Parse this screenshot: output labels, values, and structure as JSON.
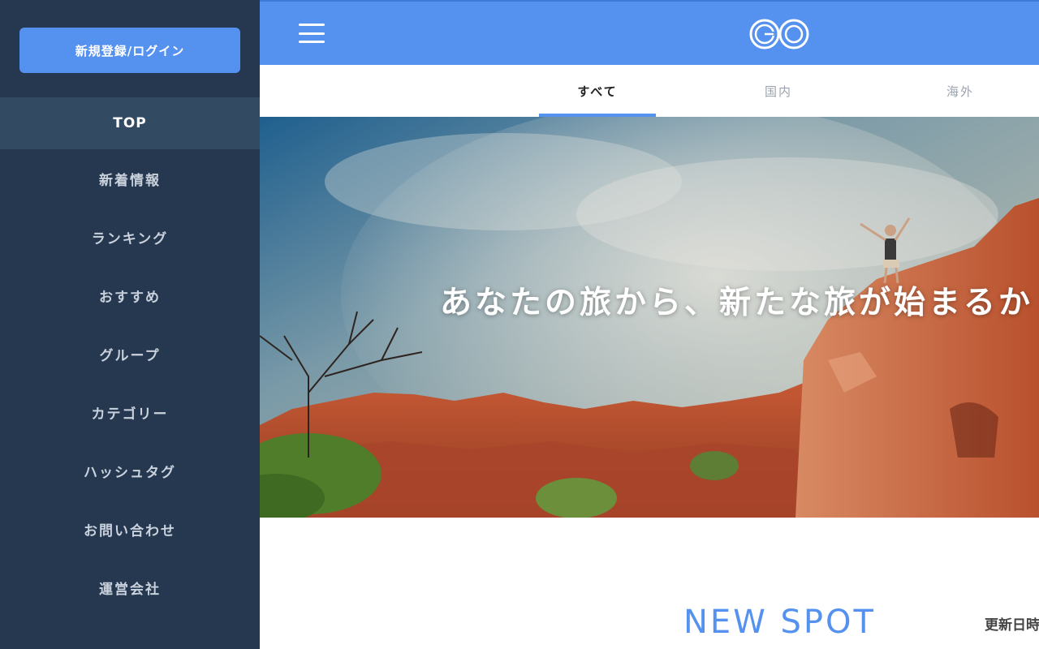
{
  "sidebar": {
    "login_label": "新規登録/ログイン",
    "items": [
      {
        "label": "TOP",
        "active": true
      },
      {
        "label": "新着情報"
      },
      {
        "label": "ランキング"
      },
      {
        "label": "おすすめ"
      },
      {
        "label": "グループ"
      },
      {
        "label": "カテゴリー"
      },
      {
        "label": "ハッシュタグ"
      },
      {
        "label": "お問い合わせ"
      },
      {
        "label": "運営会社"
      }
    ]
  },
  "header": {
    "menu_icon": "hamburger-menu-icon",
    "logo_text": "GO"
  },
  "tabs": [
    {
      "label": "すべて",
      "active": true
    },
    {
      "label": "国内"
    },
    {
      "label": "海外"
    }
  ],
  "hero": {
    "headline": "あなたの旅から、新たな旅が始まるか"
  },
  "section": {
    "title": "NEW  SPOT",
    "updated_label": "更新日時"
  },
  "colors": {
    "accent": "#5591ee",
    "sidebar_bg": "#253850",
    "sidebar_active": "#334a63"
  }
}
